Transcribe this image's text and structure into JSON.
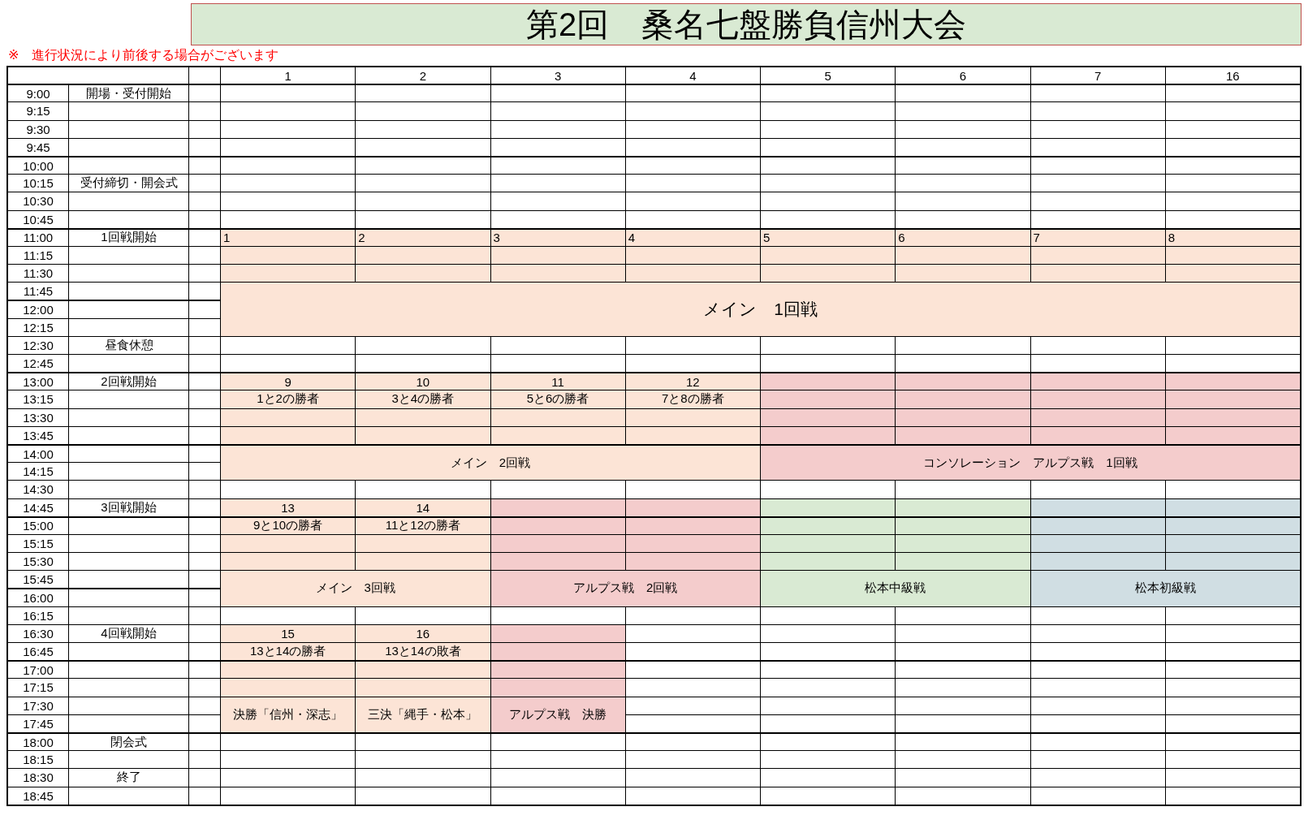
{
  "title": "第2回　桑名七盤勝負信州大会",
  "note": "※　進行状況により前後する場合がございます",
  "columns": [
    "1",
    "2",
    "3",
    "4",
    "5",
    "6",
    "7",
    "16"
  ],
  "times": [
    {
      "time": "9:00",
      "event": "開場・受付開始"
    },
    {
      "time": "9:15"
    },
    {
      "time": "9:30"
    },
    {
      "time": "9:45"
    },
    {
      "time": "10:00"
    },
    {
      "time": "10:15",
      "event": "受付締切・開会式"
    },
    {
      "time": "10:30"
    },
    {
      "time": "10:45"
    },
    {
      "time": "11:00",
      "event": "1回戦開始",
      "cells": [
        {
          "kind": "label",
          "text": "1",
          "color": "#fce4d6"
        },
        {
          "kind": "label",
          "text": "2",
          "color": "#fce4d6"
        },
        {
          "kind": "label",
          "text": "3",
          "color": "#fce4d6"
        },
        {
          "kind": "label",
          "text": "4",
          "color": "#fce4d6"
        },
        {
          "kind": "label",
          "text": "5",
          "color": "#fce4d6"
        },
        {
          "kind": "label",
          "text": "6",
          "color": "#fce4d6"
        },
        {
          "kind": "label",
          "text": "7",
          "color": "#fce4d6"
        },
        {
          "kind": "label",
          "text": "8",
          "color": "#fce4d6"
        }
      ]
    },
    {
      "time": "11:15",
      "cells": [
        {
          "kind": "fill",
          "color": "#fce4d6"
        },
        {
          "kind": "fill",
          "color": "#fce4d6"
        },
        {
          "kind": "fill",
          "color": "#fce4d6"
        },
        {
          "kind": "fill",
          "color": "#fce4d6"
        },
        {
          "kind": "fill",
          "color": "#fce4d6"
        },
        {
          "kind": "fill",
          "color": "#fce4d6"
        },
        {
          "kind": "fill",
          "color": "#fce4d6"
        },
        {
          "kind": "fill",
          "color": "#fce4d6"
        }
      ]
    },
    {
      "time": "11:30",
      "cells": [
        {
          "kind": "fill",
          "color": "#fce4d6"
        },
        {
          "kind": "fill",
          "color": "#fce4d6"
        },
        {
          "kind": "fill",
          "color": "#fce4d6"
        },
        {
          "kind": "fill",
          "color": "#fce4d6"
        },
        {
          "kind": "fill",
          "color": "#fce4d6"
        },
        {
          "kind": "fill",
          "color": "#fce4d6"
        },
        {
          "kind": "fill",
          "color": "#fce4d6"
        },
        {
          "kind": "fill",
          "color": "#fce4d6"
        }
      ]
    },
    {
      "time": "11:45",
      "cells": [
        {
          "kind": "heading",
          "text": "メイン　1回戦",
          "color": "#fce4d6"
        },
        {
          "kind": "join-left"
        },
        {
          "kind": "join-left"
        },
        {
          "kind": "join-left"
        },
        {
          "kind": "join-left"
        },
        {
          "kind": "join-left"
        },
        {
          "kind": "join-left"
        },
        {
          "kind": "join-left"
        }
      ]
    },
    {
      "time": "12:00",
      "cells": [
        {
          "kind": "join-up"
        },
        {
          "kind": "join-up"
        },
        {
          "kind": "join-up"
        },
        {
          "kind": "join-up"
        },
        {
          "kind": "join-up"
        },
        {
          "kind": "join-up"
        },
        {
          "kind": "join-up"
        },
        {
          "kind": "join-up"
        }
      ]
    },
    {
      "time": "12:15",
      "cells": [
        {
          "kind": "join-up"
        },
        {
          "kind": "join-up"
        },
        {
          "kind": "join-up"
        },
        {
          "kind": "join-up"
        },
        {
          "kind": "join-up"
        },
        {
          "kind": "join-up"
        },
        {
          "kind": "join-up"
        },
        {
          "kind": "join-up"
        }
      ]
    },
    {
      "time": "12:30",
      "event": "昼食休憩"
    },
    {
      "time": "12:45"
    },
    {
      "time": "13:00",
      "event": "2回戦開始",
      "cells": [
        {
          "kind": "text",
          "text": "9",
          "color": "#fce4d6"
        },
        {
          "kind": "text",
          "text": "10",
          "color": "#fce4d6"
        },
        {
          "kind": "text",
          "text": "11",
          "color": "#fce4d6"
        },
        {
          "kind": "text",
          "text": "12",
          "color": "#fce4d6"
        },
        {
          "kind": "fill",
          "color": "#f4cccc"
        },
        {
          "kind": "fill",
          "color": "#f4cccc"
        },
        {
          "kind": "fill",
          "color": "#f4cccc"
        },
        {
          "kind": "fill",
          "color": "#f4cccc"
        }
      ]
    },
    {
      "time": "13:15",
      "cells": [
        {
          "kind": "text",
          "text": "1と2の勝者",
          "color": "#fce4d6"
        },
        {
          "kind": "text",
          "text": "3と4の勝者",
          "color": "#fce4d6"
        },
        {
          "kind": "text",
          "text": "5と6の勝者",
          "color": "#fce4d6"
        },
        {
          "kind": "text",
          "text": "7と8の勝者",
          "color": "#fce4d6"
        },
        {
          "kind": "fill",
          "color": "#f4cccc"
        },
        {
          "kind": "fill",
          "color": "#f4cccc"
        },
        {
          "kind": "fill",
          "color": "#f4cccc"
        },
        {
          "kind": "fill",
          "color": "#f4cccc"
        }
      ]
    },
    {
      "time": "13:30",
      "cells": [
        {
          "kind": "fill",
          "color": "#fce4d6"
        },
        {
          "kind": "fill",
          "color": "#fce4d6"
        },
        {
          "kind": "fill",
          "color": "#fce4d6"
        },
        {
          "kind": "fill",
          "color": "#fce4d6"
        },
        {
          "kind": "fill",
          "color": "#f4cccc"
        },
        {
          "kind": "fill",
          "color": "#f4cccc"
        },
        {
          "kind": "fill",
          "color": "#f4cccc"
        },
        {
          "kind": "fill",
          "color": "#f4cccc"
        }
      ]
    },
    {
      "time": "13:45",
      "cells": [
        {
          "kind": "fill",
          "color": "#fce4d6"
        },
        {
          "kind": "fill",
          "color": "#fce4d6"
        },
        {
          "kind": "fill",
          "color": "#fce4d6"
        },
        {
          "kind": "fill",
          "color": "#fce4d6"
        },
        {
          "kind": "fill",
          "color": "#f4cccc"
        },
        {
          "kind": "fill",
          "color": "#f4cccc"
        },
        {
          "kind": "fill",
          "color": "#f4cccc"
        },
        {
          "kind": "fill",
          "color": "#f4cccc"
        }
      ]
    },
    {
      "time": "14:00",
      "cells": [
        {
          "kind": "text",
          "text": "メイン　2回戦",
          "color": "#fce4d6"
        },
        {
          "kind": "join-left"
        },
        {
          "kind": "join-left"
        },
        {
          "kind": "join-left"
        },
        {
          "kind": "text",
          "text": "コンソレーション　アルプス戦　1回戦",
          "color": "#f4cccc"
        },
        {
          "kind": "join-left"
        },
        {
          "kind": "join-left"
        },
        {
          "kind": "join-left"
        }
      ]
    },
    {
      "time": "14:15",
      "cells": [
        {
          "kind": "join-up"
        },
        {
          "kind": "join-up"
        },
        {
          "kind": "join-up"
        },
        {
          "kind": "join-up"
        },
        {
          "kind": "join-up"
        },
        {
          "kind": "join-up"
        },
        {
          "kind": "join-up"
        },
        {
          "kind": "join-up"
        }
      ]
    },
    {
      "time": "14:30"
    },
    {
      "time": "14:45",
      "event": "3回戦開始",
      "cells": [
        {
          "kind": "text",
          "text": "13",
          "color": "#fce4d6"
        },
        {
          "kind": "text",
          "text": "14",
          "color": "#fce4d6"
        },
        {
          "kind": "fill",
          "color": "#f4cccc"
        },
        {
          "kind": "fill",
          "color": "#f4cccc"
        },
        {
          "kind": "fill",
          "color": "#d9ead3"
        },
        {
          "kind": "fill",
          "color": "#d9ead3"
        },
        {
          "kind": "fill",
          "color": "#d0dee3"
        },
        {
          "kind": "fill",
          "color": "#d0dee3"
        }
      ]
    },
    {
      "time": "15:00",
      "cells": [
        {
          "kind": "text",
          "text": "9と10の勝者",
          "color": "#fce4d6"
        },
        {
          "kind": "text",
          "text": "11と12の勝者",
          "color": "#fce4d6"
        },
        {
          "kind": "fill",
          "color": "#f4cccc"
        },
        {
          "kind": "fill",
          "color": "#f4cccc"
        },
        {
          "kind": "fill",
          "color": "#d9ead3"
        },
        {
          "kind": "fill",
          "color": "#d9ead3"
        },
        {
          "kind": "fill",
          "color": "#d0dee3"
        },
        {
          "kind": "fill",
          "color": "#d0dee3"
        }
      ]
    },
    {
      "time": "15:15",
      "cells": [
        {
          "kind": "fill",
          "color": "#fce4d6"
        },
        {
          "kind": "fill",
          "color": "#fce4d6"
        },
        {
          "kind": "fill",
          "color": "#f4cccc"
        },
        {
          "kind": "fill",
          "color": "#f4cccc"
        },
        {
          "kind": "fill",
          "color": "#d9ead3"
        },
        {
          "kind": "fill",
          "color": "#d9ead3"
        },
        {
          "kind": "fill",
          "color": "#d0dee3"
        },
        {
          "kind": "fill",
          "color": "#d0dee3"
        }
      ]
    },
    {
      "time": "15:30",
      "cells": [
        {
          "kind": "fill",
          "color": "#fce4d6"
        },
        {
          "kind": "fill",
          "color": "#fce4d6"
        },
        {
          "kind": "fill",
          "color": "#f4cccc"
        },
        {
          "kind": "fill",
          "color": "#f4cccc"
        },
        {
          "kind": "fill",
          "color": "#d9ead3"
        },
        {
          "kind": "fill",
          "color": "#d9ead3"
        },
        {
          "kind": "fill",
          "color": "#d0dee3"
        },
        {
          "kind": "fill",
          "color": "#d0dee3"
        }
      ]
    },
    {
      "time": "15:45",
      "cells": [
        {
          "kind": "text",
          "text": "メイン　3回戦",
          "color": "#fce4d6"
        },
        {
          "kind": "join-left"
        },
        {
          "kind": "text",
          "text": "アルプス戦　2回戦",
          "color": "#f4cccc"
        },
        {
          "kind": "join-left"
        },
        {
          "kind": "text",
          "text": "松本中級戦",
          "color": "#d9ead3"
        },
        {
          "kind": "join-left"
        },
        {
          "kind": "text",
          "text": "松本初級戦",
          "color": "#d0dee3"
        },
        {
          "kind": "join-left"
        }
      ]
    },
    {
      "time": "16:00",
      "cells": [
        {
          "kind": "join-up"
        },
        {
          "kind": "join-up"
        },
        {
          "kind": "join-up"
        },
        {
          "kind": "join-up"
        },
        {
          "kind": "join-up"
        },
        {
          "kind": "join-up"
        },
        {
          "kind": "join-up"
        },
        {
          "kind": "join-up"
        }
      ]
    },
    {
      "time": "16:15"
    },
    {
      "time": "16:30",
      "event": "4回戦開始",
      "cells": [
        {
          "kind": "text",
          "text": "15",
          "color": "#fce4d6"
        },
        {
          "kind": "text",
          "text": "16",
          "color": "#fce4d6"
        },
        {
          "kind": "fill",
          "color": "#f4cccc"
        }
      ]
    },
    {
      "time": "16:45",
      "cells": [
        {
          "kind": "text",
          "text": "13と14の勝者",
          "color": "#fce4d6"
        },
        {
          "kind": "text",
          "text": "13と14の敗者",
          "color": "#fce4d6"
        },
        {
          "kind": "fill",
          "color": "#f4cccc"
        }
      ]
    },
    {
      "time": "17:00",
      "cells": [
        {
          "kind": "fill",
          "color": "#fce4d6"
        },
        {
          "kind": "fill",
          "color": "#fce4d6"
        },
        {
          "kind": "fill",
          "color": "#f4cccc"
        }
      ]
    },
    {
      "time": "17:15",
      "cells": [
        {
          "kind": "fill",
          "color": "#fce4d6"
        },
        {
          "kind": "fill",
          "color": "#fce4d6"
        },
        {
          "kind": "fill",
          "color": "#f4cccc"
        }
      ]
    },
    {
      "time": "17:30",
      "cells": [
        {
          "kind": "text",
          "text": "決勝「信州・深志」",
          "color": "#fce4d6"
        },
        {
          "kind": "text",
          "text": "三決「縄手・松本」",
          "color": "#fce4d6"
        },
        {
          "kind": "text",
          "text": "アルプス戦　決勝",
          "color": "#f4cccc"
        }
      ]
    },
    {
      "time": "17:45",
      "cells": [
        {
          "kind": "join-up"
        },
        {
          "kind": "join-up"
        },
        {
          "kind": "join-up"
        }
      ]
    },
    {
      "time": "18:00",
      "event": "閉会式"
    },
    {
      "time": "18:15"
    },
    {
      "time": "18:30",
      "event": "終了"
    },
    {
      "time": "18:45"
    }
  ]
}
